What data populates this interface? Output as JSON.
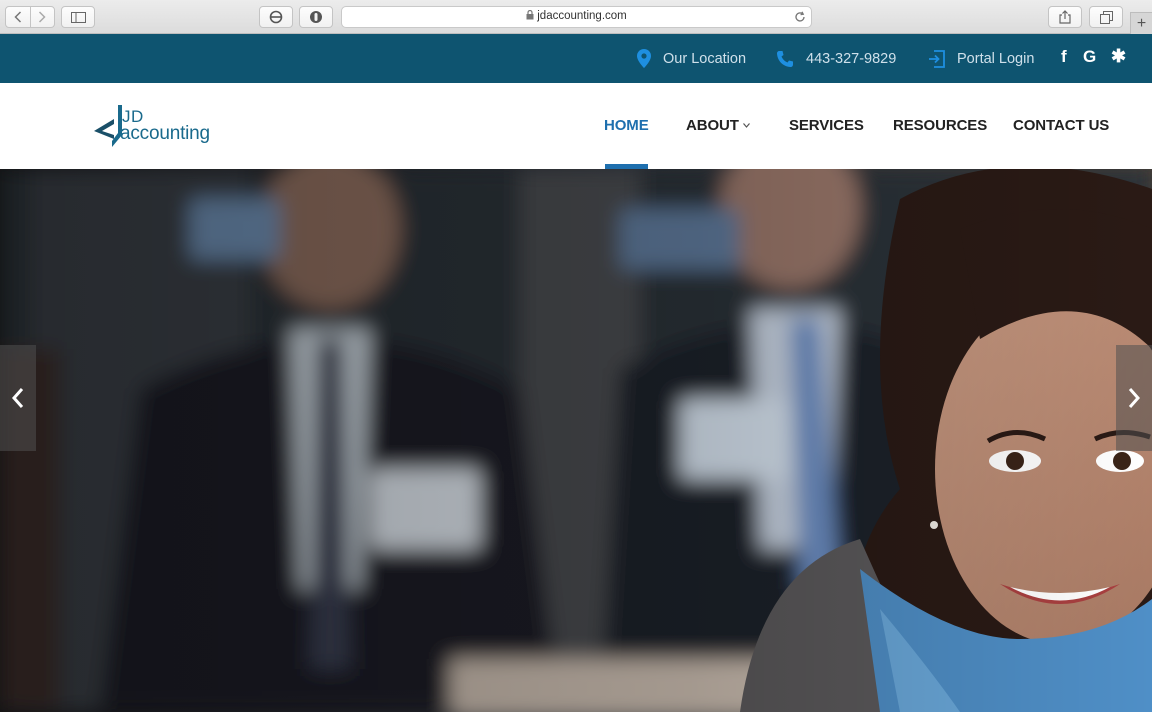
{
  "browser": {
    "url": "jdaccounting.com"
  },
  "topbar": {
    "location_label": "Our Location",
    "phone_label": "443-327-9829",
    "portal_label": "Portal Login",
    "social": {
      "facebook": "f",
      "google": "G",
      "yelp": "✱"
    }
  },
  "logo": {
    "line1": "JD",
    "line2": "accounting"
  },
  "nav": {
    "home": "HOME",
    "about": "ABOUT",
    "services": "SERVICES",
    "resources": "RESOURCES",
    "contact": "CONTACT US"
  },
  "colors": {
    "topbar_bg": "#0e5470",
    "accent": "#1e6fae",
    "brand": "#1a6a8c"
  },
  "icons": {
    "location": "map-pin-icon",
    "phone": "phone-icon",
    "portal": "login-icon",
    "prev": "chevron-left-icon",
    "next": "chevron-right-icon"
  }
}
